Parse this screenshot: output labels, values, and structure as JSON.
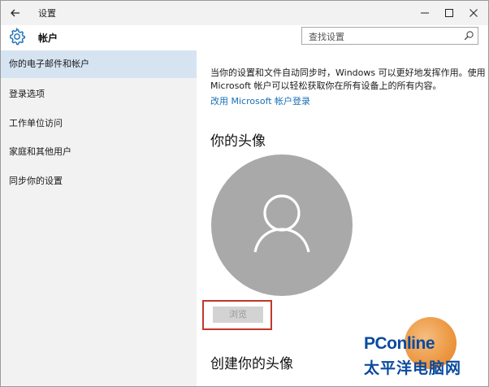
{
  "window": {
    "title": "设置",
    "controls": {
      "minimize": "minimize-icon",
      "maximize": "maximize-icon",
      "close": "close-icon"
    }
  },
  "header": {
    "title": "帐户",
    "icon": "gear-icon"
  },
  "search": {
    "placeholder": "查找设置",
    "value": ""
  },
  "sidebar": {
    "items": [
      {
        "label": "你的电子邮件和帐户",
        "active": true
      },
      {
        "label": "登录选项",
        "active": false
      },
      {
        "label": "工作单位访问",
        "active": false
      },
      {
        "label": "家庭和其他用户",
        "active": false
      },
      {
        "label": "同步你的设置",
        "active": false
      }
    ]
  },
  "main": {
    "description": "当你的设置和文件自动同步时，Windows 可以更好地发挥作用。使用 Microsoft 帐户可以轻松获取你在所有设备上的所有内容。",
    "change_link": "改用 Microsoft 帐户登录",
    "avatar_section_title": "你的头像",
    "browse_label": "浏览",
    "create_avatar_title": "创建你的头像"
  },
  "watermark": {
    "brand": "PConline",
    "sub": "太平洋电脑网"
  },
  "colors": {
    "sidebar_bg": "#f2f2f2",
    "active_item_bg": "#d6e4f2",
    "link": "#1a6fb5",
    "avatar_bg": "#a9a9a9",
    "highlight_border": "#c0392b"
  }
}
